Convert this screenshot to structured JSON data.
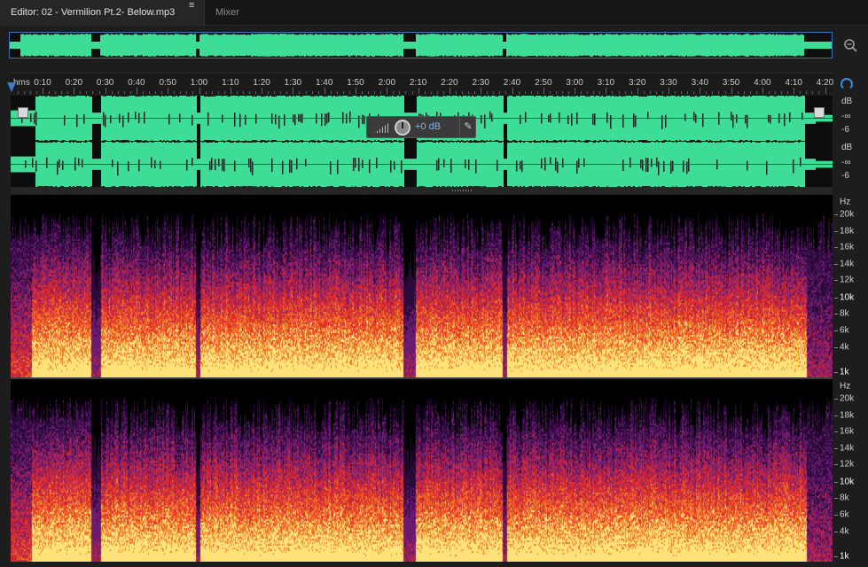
{
  "tabs": {
    "editor_label": "Editor: 02 - Vermilion Pt.2- Below.mp3",
    "menu_glyph": "≡",
    "mixer_label": "Mixer"
  },
  "toolbar": {
    "zoom_icon": "zoom-magnifier-icon"
  },
  "ruler": {
    "unit_label": "hms",
    "ticks": [
      "0:10",
      "0:20",
      "0:30",
      "0:40",
      "0:50",
      "1:00",
      "1:10",
      "1:20",
      "1:30",
      "1:40",
      "1:50",
      "2:00",
      "2:10",
      "2:20",
      "2:30",
      "2:40",
      "2:50",
      "3:00",
      "3:10",
      "3:20",
      "3:30",
      "3:40",
      "3:50",
      "4:00",
      "4:10",
      "4:20"
    ]
  },
  "hud": {
    "gain_label": "+0 dB",
    "pin_icon": "pin-icon"
  },
  "waveform": {
    "color": "#3ddc97",
    "channel_top_labels": [
      "dB",
      "-∞",
      "-6"
    ],
    "channel_bottom_labels": [
      "dB",
      "-∞",
      "-6"
    ]
  },
  "spectral": {
    "unit_label": "Hz",
    "freq_labels": [
      "20k",
      "18k",
      "16k",
      "14k",
      "12k",
      "10k",
      "8k",
      "6k",
      "4k",
      "1k"
    ],
    "colors": {
      "low": "#000000",
      "mid": "#8a1a6a",
      "hot": "#e8322a",
      "peak": "#ffe37a"
    }
  }
}
